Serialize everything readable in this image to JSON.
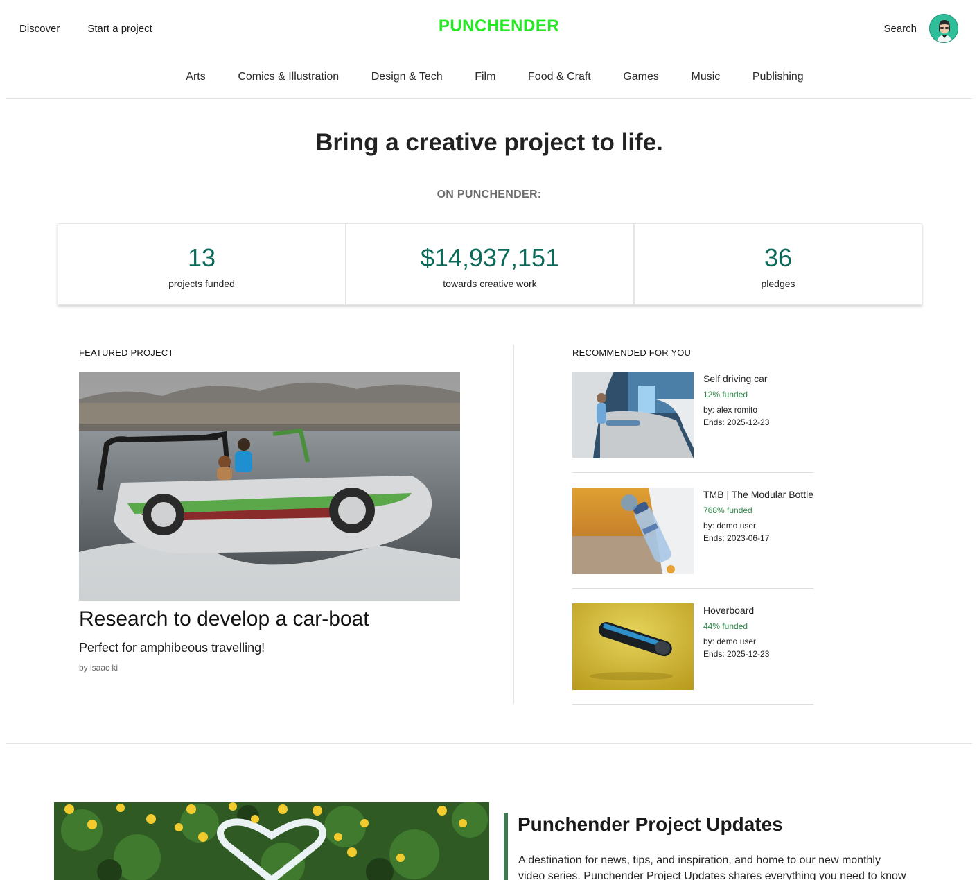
{
  "header": {
    "nav": [
      "Discover",
      "Start a project"
    ],
    "logo": "PUNCHENDER",
    "search_label": "Search",
    "avatar_icon": "user-avatar-icon"
  },
  "categories": [
    "Arts",
    "Comics & Illustration",
    "Design & Tech",
    "Film",
    "Food & Craft",
    "Games",
    "Music",
    "Publishing"
  ],
  "hero": {
    "title": "Bring a creative project to life.",
    "on_label": "ON PUNCHENDER:"
  },
  "stats": [
    {
      "value": "13",
      "label": "projects funded"
    },
    {
      "value": "$14,937,151",
      "label": "towards creative work"
    },
    {
      "value": "36",
      "label": "pledges"
    }
  ],
  "featured": {
    "section_label": "FEATURED PROJECT",
    "title": "Research to develop a car-boat",
    "description": "Perfect for amphibeous travelling!",
    "by": "by isaac ki"
  },
  "recommended": {
    "section_label": "RECOMMENDED FOR YOU",
    "items": [
      {
        "title": "Self driving car",
        "funded": "12% funded",
        "by": "by: alex romito",
        "ends": "Ends: 2025-12-23"
      },
      {
        "title": "TMB | The Modular Bottle",
        "funded": "768% funded",
        "by": "by: demo user",
        "ends": "Ends: 2023-06-17"
      },
      {
        "title": "Hoverboard",
        "funded": "44% funded",
        "by": "by: demo user",
        "ends": "Ends: 2025-12-23"
      }
    ]
  },
  "updates": {
    "title": "Punchender Project Updates",
    "text": "A destination for news, tips, and inspiration, and home to our new monthly video series. Punchender Project Updates shares everything you need to know about"
  },
  "colors": {
    "logo": "#25e825",
    "stat_number": "#0b6b5a",
    "funded": "#2f8a4c",
    "updates_bar": "#3f7a55"
  }
}
